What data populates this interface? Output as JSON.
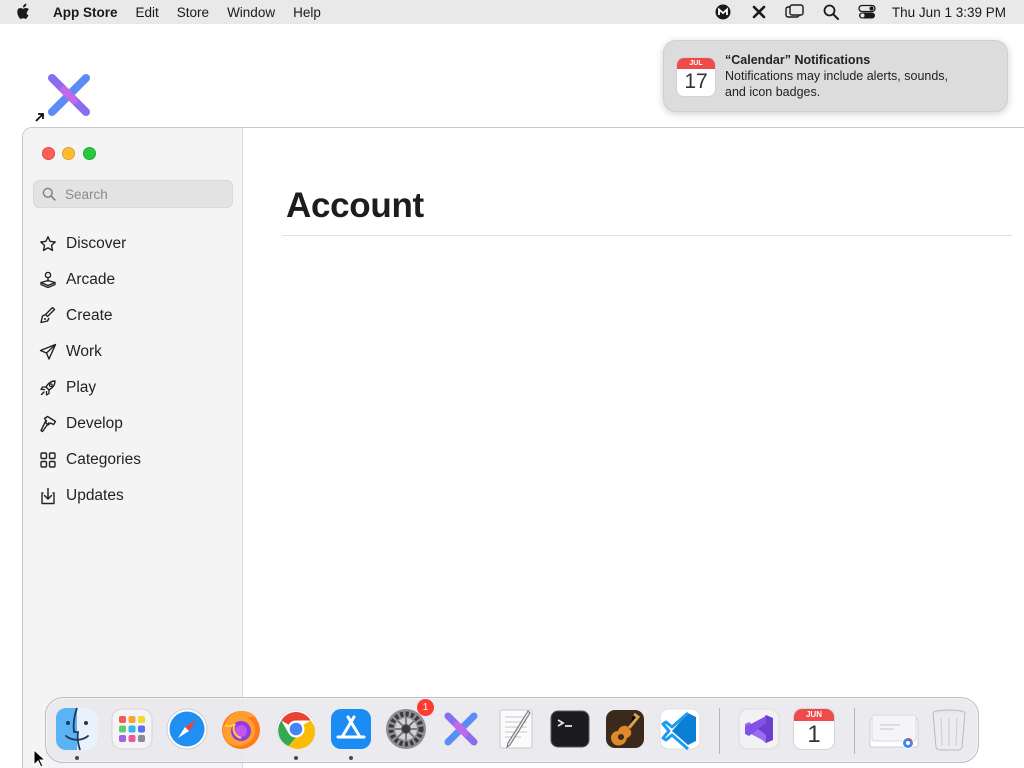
{
  "menubar": {
    "app_name": "App Store",
    "items": [
      "Edit",
      "Store",
      "Window",
      "Help"
    ],
    "clock": "Thu Jun 1  3:39 PM"
  },
  "notification": {
    "title": "“Calendar” Notifications",
    "body_line1": "Notifications may include alerts, sounds,",
    "body_line2": "and icon badges.",
    "icon_month": "JUL",
    "icon_day": "17"
  },
  "sidebar": {
    "search_placeholder": "Search",
    "items": [
      {
        "label": "Discover",
        "icon": "star-icon"
      },
      {
        "label": "Arcade",
        "icon": "joystick-icon"
      },
      {
        "label": "Create",
        "icon": "paintbrush-icon"
      },
      {
        "label": "Work",
        "icon": "paperplane-icon"
      },
      {
        "label": "Play",
        "icon": "rocket-icon"
      },
      {
        "label": "Develop",
        "icon": "hammer-icon"
      },
      {
        "label": "Categories",
        "icon": "grid-icon"
      },
      {
        "label": "Updates",
        "icon": "updates-icon"
      }
    ]
  },
  "main": {
    "title": "Account"
  },
  "dock": {
    "apps": [
      {
        "name": "Finder",
        "running": true
      },
      {
        "name": "Launchpad",
        "running": false
      },
      {
        "name": "Safari",
        "running": false
      },
      {
        "name": "Firefox",
        "running": false
      },
      {
        "name": "Google Chrome",
        "running": true
      },
      {
        "name": "App Store",
        "running": true
      },
      {
        "name": "System Settings",
        "running": false,
        "badge": "1"
      },
      {
        "name": "App",
        "running": false
      },
      {
        "name": "TextEdit",
        "running": false
      },
      {
        "name": "Terminal",
        "running": false
      },
      {
        "name": "Instruments",
        "running": false
      },
      {
        "name": "Visual Studio Code",
        "running": false
      },
      {
        "name": "Visual Studio",
        "running": false
      },
      {
        "name": "Calendar",
        "running": false,
        "month": "JUN",
        "day": "1"
      }
    ]
  },
  "colors": {
    "close": "#ff5f57",
    "minimize": "#febc2e",
    "zoom": "#28c840",
    "badge": "#ff3b30"
  }
}
